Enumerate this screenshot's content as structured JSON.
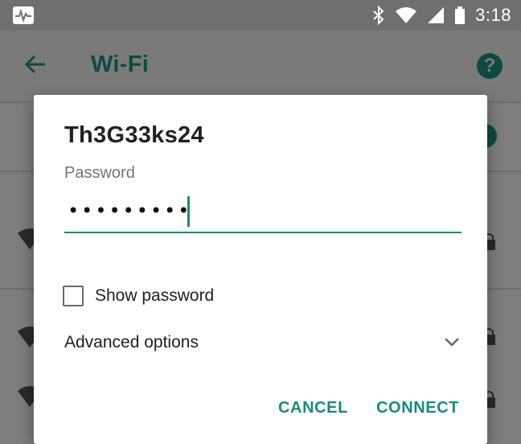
{
  "status_bar": {
    "time": "3:18",
    "icons": [
      "activity-icon",
      "bluetooth-icon",
      "wifi-signal-icon",
      "cell-signal-icon",
      "battery-icon"
    ]
  },
  "app_bar": {
    "title": "Wi-Fi",
    "back_icon": "arrow-back-icon",
    "help_icon": "help-icon",
    "help_glyph": "?"
  },
  "dialog": {
    "network_name": "Th3G33ks24",
    "password_label": "Password",
    "password_value": "•••••••••",
    "show_password_label": "Show password",
    "show_password_checked": false,
    "advanced_options_label": "Advanced options",
    "cancel_label": "CANCEL",
    "connect_label": "CONNECT"
  },
  "colors": {
    "accent": "#1a8a7a",
    "dark_accent": "#0e4a40",
    "scrim": "#7a7a7a"
  }
}
